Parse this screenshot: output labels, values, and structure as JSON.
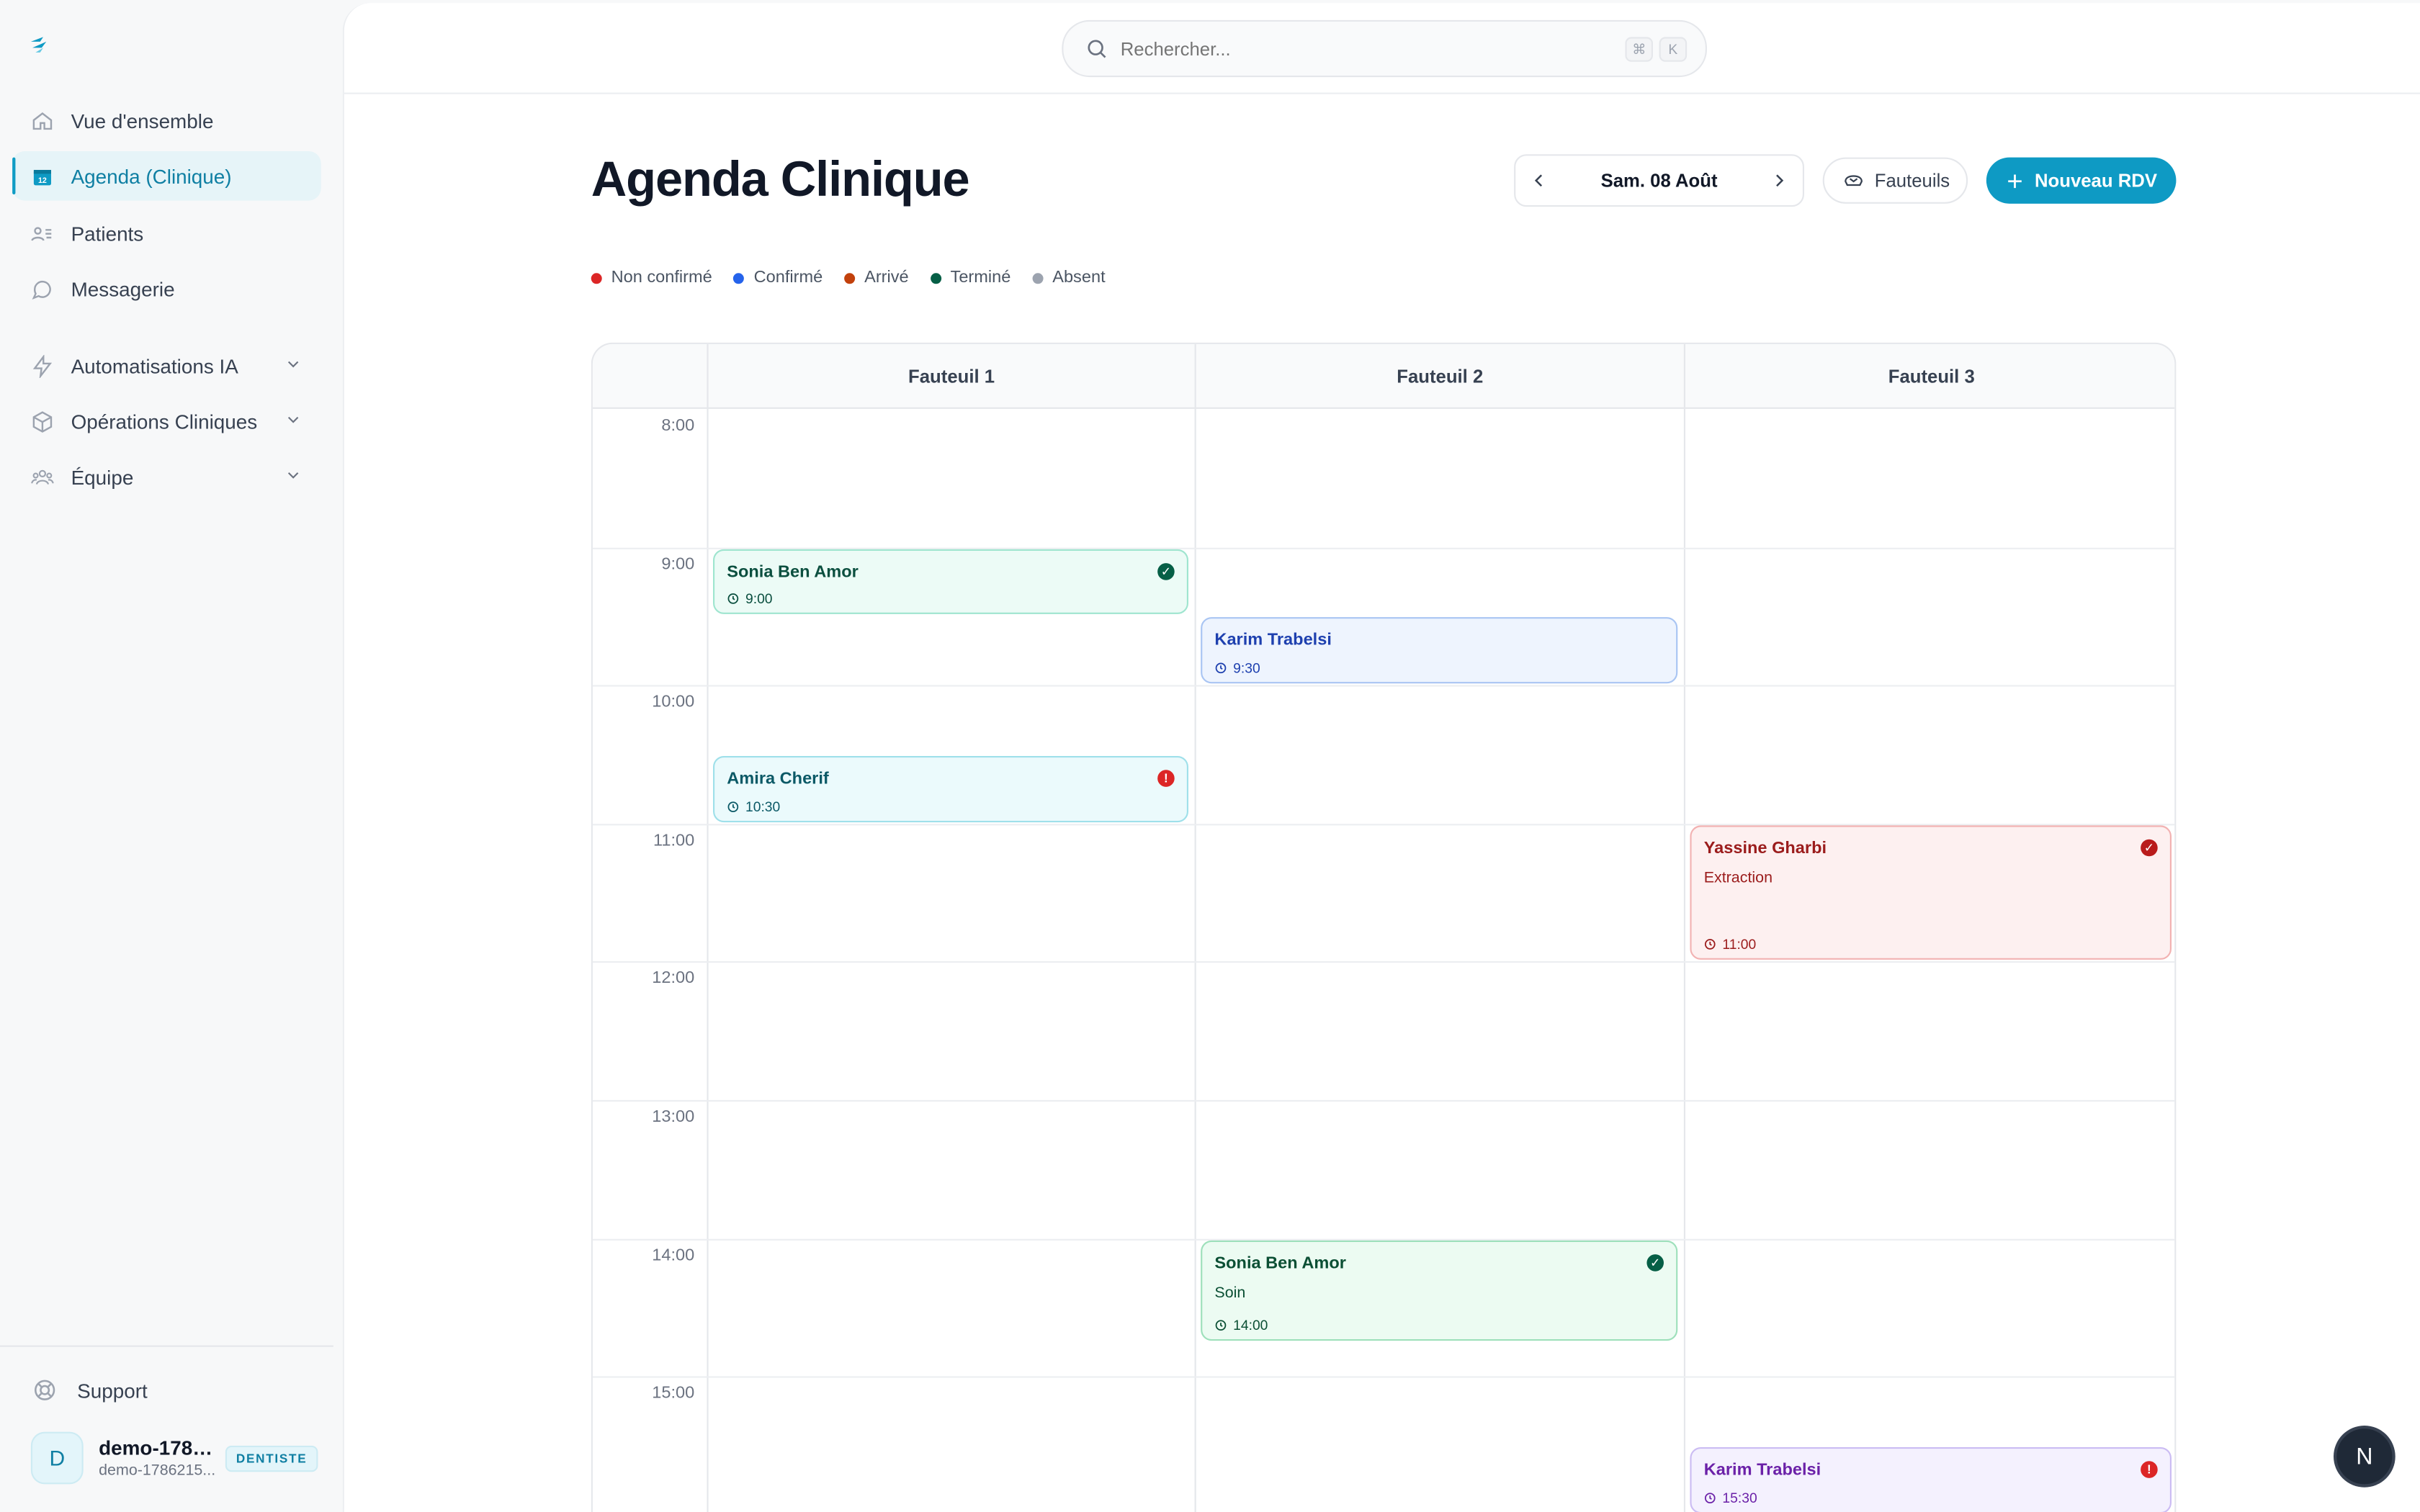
{
  "sidebar": {
    "logo": "logo-icon",
    "items": [
      {
        "label": "Vue d'ensemble",
        "icon": "home-icon",
        "active": false
      },
      {
        "label": "Agenda (Clinique)",
        "icon": "calendar-icon",
        "active": true
      },
      {
        "label": "Patients",
        "icon": "users-list-icon",
        "active": false
      },
      {
        "label": "Messagerie",
        "icon": "chat-icon",
        "active": false
      },
      {
        "label": "Automatisations IA",
        "icon": "bolt-icon",
        "active": false,
        "expandable": true
      },
      {
        "label": "Opérations Cliniques",
        "icon": "box-icon",
        "active": false,
        "expandable": true
      },
      {
        "label": "Équipe",
        "icon": "team-icon",
        "active": false,
        "expandable": true
      }
    ],
    "support_label": "Support",
    "user": {
      "initial": "D",
      "name": "demo-1786...",
      "email": "demo-1786215...",
      "role": "DENTISTE"
    }
  },
  "search": {
    "placeholder": "Rechercher...",
    "shortcut_keys": [
      "⌘",
      "K"
    ]
  },
  "header": {
    "title": "Agenda Clinique",
    "date_label": "Sam. 08 Août",
    "chairs_button": "Fauteuils",
    "new_button": "Nouveau RDV"
  },
  "legend": [
    {
      "label": "Non confirmé",
      "color": "#dc2626"
    },
    {
      "label": "Confirmé",
      "color": "#2563eb"
    },
    {
      "label": "Arrivé",
      "color": "#c2410c"
    },
    {
      "label": "Terminé",
      "color": "#065f46"
    },
    {
      "label": "Absent",
      "color": "#9ca3af"
    }
  ],
  "calendar": {
    "columns": [
      "Fauteuil 1",
      "Fauteuil 2",
      "Fauteuil 3"
    ],
    "hours": [
      "8:00",
      "9:00",
      "10:00",
      "11:00",
      "12:00",
      "13:00",
      "14:00",
      "15:00"
    ],
    "appointments": [
      {
        "chair": 0,
        "start": 9.0,
        "end": 9.5,
        "name": "Sonia Ben Amor",
        "type": "",
        "time": "9:00",
        "status": "done",
        "theme": "mint"
      },
      {
        "chair": 1,
        "start": 9.5,
        "end": 10.0,
        "name": "Karim Trabelsi",
        "type": "",
        "time": "9:30",
        "status": "",
        "theme": "blue"
      },
      {
        "chair": 0,
        "start": 10.5,
        "end": 11.0,
        "name": "Amira Cherif",
        "type": "",
        "time": "10:30",
        "status": "alert",
        "theme": "cyan"
      },
      {
        "chair": 2,
        "start": 11.0,
        "end": 12.0,
        "name": "Yassine Gharbi",
        "type": "Extraction",
        "time": "11:00",
        "status": "cancel",
        "theme": "red"
      },
      {
        "chair": 1,
        "start": 14.0,
        "end": 14.75,
        "name": "Sonia Ben Amor",
        "type": "Soin",
        "time": "14:00",
        "status": "done",
        "theme": "green"
      },
      {
        "chair": 2,
        "start": 15.5,
        "end": 16.0,
        "name": "Karim Trabelsi",
        "type": "",
        "time": "15:30",
        "status": "alert",
        "theme": "purple"
      }
    ]
  },
  "fab_label": "N"
}
